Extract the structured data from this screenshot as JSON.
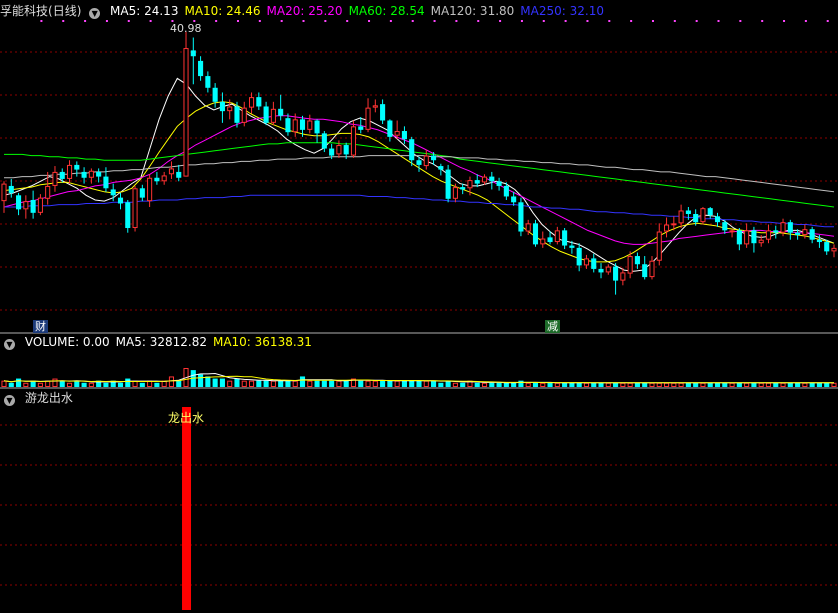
{
  "stock": {
    "name": "孚能科技",
    "period": "(日线)"
  },
  "price_header": {
    "items": [
      {
        "label": "MA5: 24.13",
        "color": "#ffffff"
      },
      {
        "label": "MA10: 24.46",
        "color": "#ffff00"
      },
      {
        "label": "MA20: 25.20",
        "color": "#ff00ff"
      },
      {
        "label": "MA60: 28.54",
        "color": "#00ff00"
      },
      {
        "label": "MA120: 31.80",
        "color": "#c0c0c0"
      },
      {
        "label": "MA250: 32.10",
        "color": "#3333ff"
      }
    ]
  },
  "volume_header": {
    "items": [
      {
        "label": "VOLUME: 0.00",
        "color": "#ffffff"
      },
      {
        "label": "MA5: 32812.82",
        "color": "#ffffff"
      },
      {
        "label": "MA10: 36138.31",
        "color": "#ffff00"
      }
    ]
  },
  "indicator_header": {
    "label": "游龙出水"
  },
  "markers": {
    "cai": "财",
    "jian": "减"
  },
  "signal_label": "龙出水",
  "high_label": "40.98",
  "colors": {
    "up": "#ff3333",
    "down": "#00ffff",
    "ma5": "#ffffff",
    "ma10": "#ffff00",
    "ma20": "#ff00ff",
    "ma60": "#00ff00",
    "ma120": "#c0c0c0",
    "ma250": "#3333ff",
    "grid": "#8b0000",
    "signal": "#ff0000"
  },
  "chart_data": {
    "type": "candlestick",
    "ylim": [
      16.5,
      42
    ],
    "candles": [
      [
        26.5,
        28.0,
        25.5,
        28.2
      ],
      [
        27.8,
        27.2,
        26.8,
        28.4
      ],
      [
        27.0,
        25.8,
        25.3,
        27.2
      ],
      [
        25.8,
        26.5,
        25.0,
        27.0
      ],
      [
        26.6,
        25.5,
        25.0,
        27.4
      ],
      [
        25.5,
        26.8,
        25.3,
        27.1
      ],
      [
        26.7,
        27.8,
        26.2,
        29.0
      ],
      [
        27.8,
        29.0,
        27.3,
        29.5
      ],
      [
        29.0,
        28.4,
        28.1,
        29.3
      ],
      [
        28.4,
        29.6,
        28.0,
        30.0
      ],
      [
        29.6,
        29.2,
        28.6,
        29.9
      ],
      [
        29.0,
        28.5,
        28.0,
        29.4
      ],
      [
        28.5,
        29.1,
        28.0,
        29.3
      ],
      [
        29.0,
        28.6,
        28.1,
        29.3
      ],
      [
        28.6,
        27.6,
        27.3,
        29.4
      ],
      [
        27.5,
        27.0,
        26.5,
        28.0
      ],
      [
        26.8,
        26.3,
        25.8,
        27.2
      ],
      [
        26.4,
        24.2,
        23.8,
        26.6
      ],
      [
        24.2,
        27.6,
        23.9,
        27.8
      ],
      [
        27.6,
        26.8,
        26.5,
        27.9
      ],
      [
        26.5,
        28.5,
        26.0,
        28.8
      ],
      [
        28.5,
        28.2,
        27.9,
        29.0
      ],
      [
        28.2,
        28.7,
        27.9,
        29.0
      ],
      [
        28.8,
        29.3,
        28.4,
        29.9
      ],
      [
        29.0,
        28.5,
        28.2,
        29.6
      ],
      [
        28.6,
        39.6,
        28.6,
        40.98
      ],
      [
        39.4,
        38.9,
        36.5,
        40.5
      ],
      [
        38.5,
        37.2,
        36.8,
        38.9
      ],
      [
        37.2,
        36.2,
        35.8,
        37.6
      ],
      [
        36.2,
        35.0,
        34.5,
        36.6
      ],
      [
        35.0,
        34.2,
        33.2,
        35.8
      ],
      [
        34.2,
        34.6,
        33.5,
        35.2
      ],
      [
        34.6,
        33.2,
        32.8,
        35.0
      ],
      [
        33.2,
        34.5,
        32.9,
        35.0
      ],
      [
        34.5,
        35.4,
        34.0,
        35.8
      ],
      [
        35.4,
        34.6,
        34.3,
        35.8
      ],
      [
        34.6,
        33.2,
        33.0,
        35.0
      ],
      [
        33.2,
        34.4,
        33.0,
        35.0
      ],
      [
        34.4,
        33.8,
        33.4,
        35.6
      ],
      [
        33.6,
        32.4,
        32.1,
        34.0
      ],
      [
        32.4,
        33.5,
        32.0,
        34.0
      ],
      [
        33.5,
        32.6,
        32.0,
        33.8
      ],
      [
        32.6,
        33.4,
        32.3,
        33.9
      ],
      [
        33.4,
        32.3,
        31.5,
        33.5
      ],
      [
        32.3,
        31.0,
        30.7,
        32.5
      ],
      [
        31.0,
        30.4,
        30.1,
        31.4
      ],
      [
        30.5,
        31.3,
        30.2,
        31.7
      ],
      [
        31.3,
        30.5,
        30.1,
        31.5
      ],
      [
        30.4,
        32.9,
        30.2,
        33.4
      ],
      [
        32.9,
        32.6,
        32.3,
        33.7
      ],
      [
        32.6,
        34.5,
        32.4,
        35.3
      ],
      [
        34.5,
        34.7,
        34.1,
        35.2
      ],
      [
        34.8,
        33.4,
        33.1,
        35.2
      ],
      [
        33.4,
        32.0,
        31.6,
        33.5
      ],
      [
        32.1,
        32.5,
        31.8,
        33.4
      ],
      [
        32.5,
        31.8,
        31.4,
        32.9
      ],
      [
        31.8,
        30.0,
        29.5,
        32.0
      ],
      [
        30.0,
        29.6,
        29.0,
        30.3
      ],
      [
        29.5,
        30.4,
        29.2,
        30.9
      ],
      [
        30.4,
        30.0,
        29.6,
        30.7
      ],
      [
        29.5,
        29.2,
        28.7,
        29.7
      ],
      [
        29.2,
        26.7,
        26.4,
        29.6
      ],
      [
        26.7,
        27.7,
        26.4,
        28.0
      ],
      [
        27.7,
        27.5,
        27.1,
        28.0
      ],
      [
        27.6,
        28.3,
        27.0,
        28.6
      ],
      [
        28.3,
        28.0,
        27.7,
        28.8
      ],
      [
        28.1,
        28.6,
        27.9,
        28.8
      ],
      [
        28.6,
        28.2,
        27.5,
        29.0
      ],
      [
        28.2,
        27.8,
        27.4,
        28.5
      ],
      [
        27.8,
        26.9,
        26.6,
        28.1
      ],
      [
        26.9,
        26.4,
        26.1,
        27.3
      ],
      [
        26.4,
        23.9,
        23.5,
        26.8
      ],
      [
        23.9,
        24.6,
        23.6,
        24.9
      ],
      [
        24.6,
        22.8,
        22.6,
        24.9
      ],
      [
        22.8,
        23.3,
        22.5,
        23.9
      ],
      [
        23.4,
        23.0,
        22.8,
        23.9
      ],
      [
        23.0,
        24.0,
        22.8,
        24.3
      ],
      [
        24.0,
        22.7,
        22.4,
        24.2
      ],
      [
        22.7,
        22.5,
        22.0,
        23.1
      ],
      [
        22.5,
        21.0,
        20.5,
        22.9
      ],
      [
        21.0,
        21.6,
        20.7,
        21.9
      ],
      [
        21.6,
        20.7,
        20.4,
        22.0
      ],
      [
        20.7,
        20.4,
        19.9,
        21.2
      ],
      [
        20.4,
        20.9,
        20.2,
        21.1
      ],
      [
        20.9,
        19.7,
        18.5,
        21.2
      ],
      [
        19.7,
        20.4,
        19.3,
        20.8
      ],
      [
        20.3,
        21.8,
        19.9,
        22.2
      ],
      [
        21.8,
        21.1,
        20.7,
        22.1
      ],
      [
        21.1,
        20.0,
        19.8,
        21.8
      ],
      [
        20.0,
        21.4,
        19.8,
        21.8
      ],
      [
        21.4,
        23.9,
        21.0,
        24.6
      ],
      [
        23.9,
        24.5,
        23.4,
        25.1
      ],
      [
        24.5,
        24.6,
        24.0,
        25.2
      ],
      [
        24.6,
        25.7,
        24.2,
        26.2
      ],
      [
        25.7,
        25.4,
        24.9,
        26.0
      ],
      [
        25.4,
        24.7,
        24.4,
        25.8
      ],
      [
        24.7,
        25.9,
        24.5,
        26.0
      ],
      [
        25.9,
        25.3,
        25.0,
        26.0
      ],
      [
        25.2,
        24.7,
        24.3,
        25.5
      ],
      [
        24.7,
        24.0,
        23.7,
        24.9
      ],
      [
        23.9,
        24.0,
        23.4,
        24.1
      ],
      [
        24.0,
        22.8,
        22.3,
        24.2
      ],
      [
        22.8,
        24.0,
        22.5,
        24.6
      ],
      [
        24.0,
        22.9,
        22.1,
        24.3
      ],
      [
        22.9,
        23.2,
        22.6,
        23.6
      ],
      [
        23.2,
        24.0,
        22.9,
        24.5
      ],
      [
        24.0,
        23.8,
        23.3,
        24.4
      ],
      [
        23.8,
        24.7,
        23.5,
        25.0
      ],
      [
        24.7,
        23.8,
        23.2,
        24.9
      ],
      [
        23.8,
        23.6,
        23.2,
        24.1
      ],
      [
        23.6,
        24.1,
        23.3,
        24.5
      ],
      [
        24.1,
        23.2,
        22.9,
        24.3
      ],
      [
        23.2,
        23.0,
        22.5,
        23.6
      ],
      [
        23.0,
        22.2,
        21.9,
        23.2
      ],
      [
        22.2,
        22.5,
        21.7,
        22.8
      ]
    ],
    "ma": {
      "MA5": [
        27.0,
        27.2,
        27.5,
        27.8,
        28.2,
        28.6,
        28.4,
        28.0,
        27.6,
        27.0,
        26.6,
        26.5,
        26.8,
        27.4,
        28.0,
        28.5,
        31.0,
        33.5,
        35.5,
        37.0,
        36.5,
        35.5,
        34.7,
        34.3,
        34.6,
        34.8,
        34.3,
        33.8,
        33.4,
        33.0,
        32.5,
        31.8,
        31.3,
        30.9,
        30.6,
        31.0,
        31.8,
        32.7,
        33.3,
        33.6,
        33.4,
        33.0,
        32.6,
        31.9,
        31.2,
        30.5,
        30.0,
        29.7,
        29.2,
        28.6,
        28.0,
        27.8,
        27.8,
        28.0,
        28.2,
        28.0,
        27.5,
        26.7,
        25.5,
        24.5,
        23.8,
        23.2,
        23.0,
        22.8,
        22.4,
        21.9,
        21.4,
        21.0,
        20.6,
        20.5,
        20.6,
        21.2,
        22.0,
        22.9,
        23.8,
        24.6,
        25.2,
        25.3,
        25.2,
        24.8,
        24.2,
        23.8,
        23.5,
        23.4,
        23.5,
        23.8,
        24.0,
        24.0,
        23.8,
        23.5,
        23.2,
        22.9
      ],
      "MA10": [
        27.4,
        27.5,
        27.6,
        27.7,
        27.9,
        28.0,
        28.1,
        28.1,
        27.9,
        27.7,
        27.5,
        27.3,
        27.2,
        27.3,
        27.6,
        28.4,
        29.5,
        30.7,
        31.8,
        32.9,
        33.6,
        34.2,
        34.6,
        34.9,
        35.0,
        34.9,
        34.5,
        34.0,
        33.6,
        33.2,
        32.9,
        32.6,
        32.4,
        32.2,
        32.1,
        32.1,
        32.2,
        32.3,
        32.3,
        32.2,
        32.0,
        31.6,
        31.1,
        30.6,
        30.1,
        29.6,
        29.1,
        28.6,
        28.2,
        27.9,
        27.6,
        27.3,
        27.0,
        26.6,
        26.0,
        25.4,
        24.8,
        24.2,
        23.6,
        23.1,
        22.6,
        22.2,
        21.9,
        21.6,
        21.4,
        21.3,
        21.3,
        21.4,
        21.7,
        22.1,
        22.6,
        23.1,
        23.6,
        24.0,
        24.3,
        24.5,
        24.6,
        24.5,
        24.4,
        24.2,
        24.1,
        24.0,
        23.9,
        23.8,
        23.8,
        23.8,
        23.7,
        23.6,
        23.5,
        23.3,
        23.1,
        22.9
      ],
      "MA20": [
        26.0,
        26.2,
        26.4,
        26.5,
        26.7,
        26.9,
        27.1,
        27.3,
        27.4,
        27.6,
        27.8,
        27.9,
        28.1,
        28.2,
        28.3,
        28.5,
        28.8,
        29.3,
        29.9,
        30.4,
        30.8,
        31.3,
        31.7,
        32.1,
        32.5,
        32.9,
        33.2,
        33.4,
        33.6,
        33.7,
        33.8,
        33.8,
        33.7,
        33.6,
        33.5,
        33.5,
        33.4,
        33.3,
        33.1,
        33.0,
        32.8,
        32.6,
        32.3,
        32.0,
        31.7,
        31.4,
        31.0,
        30.6,
        30.2,
        29.8,
        29.4,
        29.1,
        28.7,
        28.4,
        28.0,
        27.6,
        27.2,
        26.8,
        26.4,
        26.0,
        25.6,
        25.2,
        24.8,
        24.4,
        24.0,
        23.7,
        23.4,
        23.1,
        22.9,
        22.8,
        22.8,
        22.9,
        23.0,
        23.1,
        23.3,
        23.4,
        23.5,
        23.6,
        23.7,
        23.8,
        23.9,
        23.9,
        24.0,
        24.0,
        23.9,
        23.9,
        23.9,
        23.8,
        23.8,
        23.7,
        23.6,
        23.5
      ],
      "MA60": [
        30.5,
        30.5,
        30.5,
        30.4,
        30.4,
        30.3,
        30.3,
        30.2,
        30.2,
        30.1,
        30.1,
        30.0,
        30.0,
        30.0,
        30.0,
        30.0,
        30.1,
        30.2,
        30.3,
        30.4,
        30.5,
        30.6,
        30.7,
        30.8,
        30.9,
        31.0,
        31.1,
        31.2,
        31.3,
        31.4,
        31.4,
        31.5,
        31.5,
        31.5,
        31.5,
        31.5,
        31.5,
        31.4,
        31.4,
        31.3,
        31.2,
        31.1,
        31.0,
        30.9,
        30.8,
        30.7,
        30.6,
        30.5,
        30.4,
        30.3,
        30.1,
        30.0,
        29.9,
        29.8,
        29.7,
        29.6,
        29.5,
        29.4,
        29.3,
        29.2,
        29.1,
        29.0,
        28.9,
        28.8,
        28.7,
        28.6,
        28.5,
        28.4,
        28.3,
        28.2,
        28.1,
        28.0,
        27.9,
        27.8,
        27.7,
        27.6,
        27.5,
        27.4,
        27.3,
        27.2,
        27.1,
        27.0,
        26.9,
        26.8,
        26.7,
        26.6,
        26.5,
        26.4,
        26.3,
        26.2,
        26.1,
        26.0
      ],
      "MA120": [
        28.5,
        28.5,
        28.6,
        28.6,
        28.7,
        28.7,
        28.8,
        28.8,
        28.9,
        28.9,
        29.0,
        29.0,
        29.1,
        29.1,
        29.2,
        29.2,
        29.3,
        29.4,
        29.4,
        29.5,
        29.6,
        29.6,
        29.7,
        29.7,
        29.8,
        29.8,
        29.9,
        29.9,
        30.0,
        30.0,
        30.1,
        30.1,
        30.1,
        30.2,
        30.2,
        30.2,
        30.3,
        30.3,
        30.3,
        30.3,
        30.4,
        30.4,
        30.4,
        30.4,
        30.4,
        30.4,
        30.4,
        30.3,
        30.3,
        30.3,
        30.2,
        30.2,
        30.2,
        30.1,
        30.1,
        30.0,
        30.0,
        29.9,
        29.9,
        29.8,
        29.8,
        29.7,
        29.7,
        29.6,
        29.6,
        29.5,
        29.4,
        29.4,
        29.3,
        29.2,
        29.2,
        29.1,
        29.0,
        29.0,
        28.9,
        28.8,
        28.7,
        28.6,
        28.6,
        28.5,
        28.4,
        28.3,
        28.2,
        28.1,
        28.0,
        27.9,
        27.8,
        27.7,
        27.6,
        27.5,
        27.4,
        27.3
      ],
      "MA250": [
        26.0,
        26.0,
        26.0,
        26.1,
        26.1,
        26.1,
        26.2,
        26.2,
        26.2,
        26.3,
        26.3,
        26.3,
        26.4,
        26.4,
        26.4,
        26.5,
        26.5,
        26.6,
        26.6,
        26.6,
        26.7,
        26.7,
        26.8,
        26.8,
        26.8,
        26.9,
        26.9,
        27.0,
        27.0,
        27.0,
        27.0,
        27.0,
        27.0,
        27.0,
        27.0,
        27.0,
        27.0,
        27.0,
        27.0,
        27.0,
        26.9,
        26.9,
        26.9,
        26.8,
        26.8,
        26.7,
        26.7,
        26.6,
        26.6,
        26.5,
        26.5,
        26.4,
        26.4,
        26.3,
        26.3,
        26.2,
        26.2,
        26.1,
        26.0,
        26.0,
        25.9,
        25.9,
        25.8,
        25.8,
        25.7,
        25.6,
        25.6,
        25.5,
        25.5,
        25.4,
        25.4,
        25.3,
        25.3,
        25.2,
        25.2,
        25.1,
        25.1,
        25.0,
        25.0,
        24.9,
        24.9,
        24.8,
        24.8,
        24.7,
        24.7,
        24.6,
        24.6,
        24.5,
        24.5,
        24.4,
        24.3,
        24.3
      ]
    },
    "volume": [
      3,
      2,
      4,
      2,
      3,
      2,
      3,
      4,
      3,
      2,
      3,
      2,
      2,
      3,
      2,
      3,
      2,
      4,
      3,
      2,
      3,
      2,
      3,
      5,
      3,
      9,
      8,
      6,
      5,
      4,
      4,
      3,
      4,
      3,
      3,
      3,
      3,
      3,
      3,
      3,
      3,
      5,
      3,
      3,
      3,
      3,
      3,
      3,
      4,
      3,
      3,
      3,
      3,
      3,
      3,
      3,
      3,
      3,
      3,
      3,
      2,
      3,
      2,
      2,
      3,
      2,
      2,
      2,
      2,
      2,
      2,
      3,
      2,
      2,
      2,
      2,
      2,
      2,
      2,
      2,
      2,
      2,
      2,
      2,
      2,
      2,
      2,
      2,
      2,
      2,
      2,
      2,
      2,
      2,
      2,
      2,
      2,
      2,
      2,
      2,
      2,
      2,
      2,
      2,
      2,
      2,
      2,
      2,
      2,
      2,
      2,
      2,
      2,
      2,
      2,
      2,
      2,
      2,
      2,
      2
    ],
    "signal_index": 25
  }
}
